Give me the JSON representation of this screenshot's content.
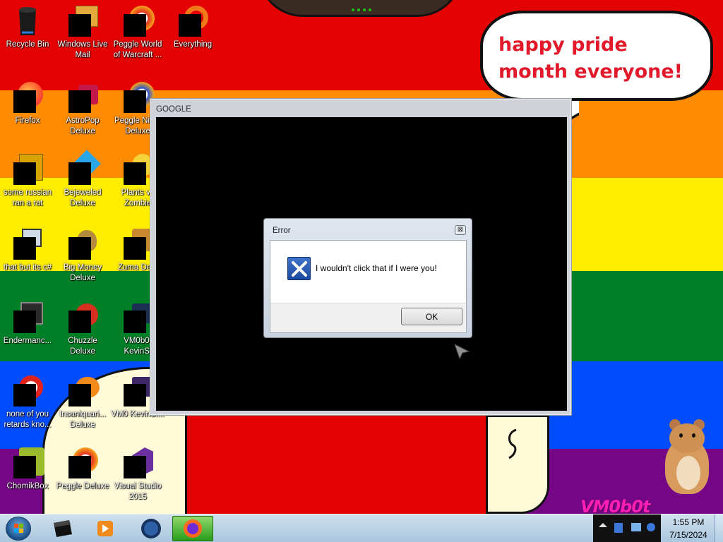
{
  "colors": {
    "pride_stripes": [
      "#e40303",
      "#ff8c00",
      "#ffed00",
      "#008026",
      "#004dff",
      "#750787"
    ],
    "speech_text": "#e2192a",
    "watermark": "#ff1fb5",
    "taskbar": "#b8d2e6"
  },
  "wallpaper": {
    "speech_bubble": "happy pride month everyone!",
    "watermark": "VM0b0t"
  },
  "desktop_icons": [
    {
      "label": "Recycle Bin",
      "icon": "recycle-bin-icon"
    },
    {
      "label": "Windows Live Mail",
      "icon": "mail-icon"
    },
    {
      "label": "Peggle World of Warcraft ...",
      "icon": "peggle-icon"
    },
    {
      "label": "Everything",
      "icon": "search-tool-icon"
    },
    {
      "label": "Firefox",
      "icon": "firefox-icon"
    },
    {
      "label": "AstroPop Deluxe",
      "icon": "game-icon"
    },
    {
      "label": "Peggle Nig... Deluxe",
      "icon": "peggle-icon"
    },
    {
      "label": "some russian ran a rat",
      "icon": "document-icon"
    },
    {
      "label": "Bejeweled Deluxe",
      "icon": "gem-icon"
    },
    {
      "label": "Plants vs Zombie",
      "icon": "game-icon"
    },
    {
      "label": "that but its c#",
      "icon": "shortcut-icon"
    },
    {
      "label": "Big Money Deluxe",
      "icon": "money-bag-icon"
    },
    {
      "label": "Zuma Delu",
      "icon": "game-icon"
    },
    {
      "label": "Endermanc...",
      "icon": "terminal-icon"
    },
    {
      "label": "Chuzzle Deluxe",
      "icon": "game-icon"
    },
    {
      "label": "VM0b0t KevinSi",
      "icon": "video-icon"
    },
    {
      "label": "none of you retards kno...",
      "icon": "browser-icon"
    },
    {
      "label": "Insaniquari... Deluxe",
      "icon": "fish-icon"
    },
    {
      "label": "VM0 KevinSi...",
      "icon": "video-icon"
    },
    {
      "label": "ChomikBox",
      "icon": "hamster-app-icon"
    },
    {
      "label": "Peggle Deluxe",
      "icon": "peggle-icon"
    },
    {
      "label": "Visual Studio 2015",
      "icon": "visual-studio-icon"
    }
  ],
  "google_window": {
    "title": "GOOGLE"
  },
  "error_dialog": {
    "title": "Error",
    "close_glyph": "⊠",
    "message": "I wouldn't click that if I were you!",
    "ok_label": "OK"
  },
  "taskbar": {
    "pinned": [
      {
        "icon": "window-icon"
      },
      {
        "icon": "media-player-icon"
      },
      {
        "icon": "globe-icon"
      },
      {
        "icon": "firefox-icon",
        "active": true
      }
    ],
    "clock": {
      "time": "1:55 PM",
      "date": "7/15/2024"
    }
  }
}
